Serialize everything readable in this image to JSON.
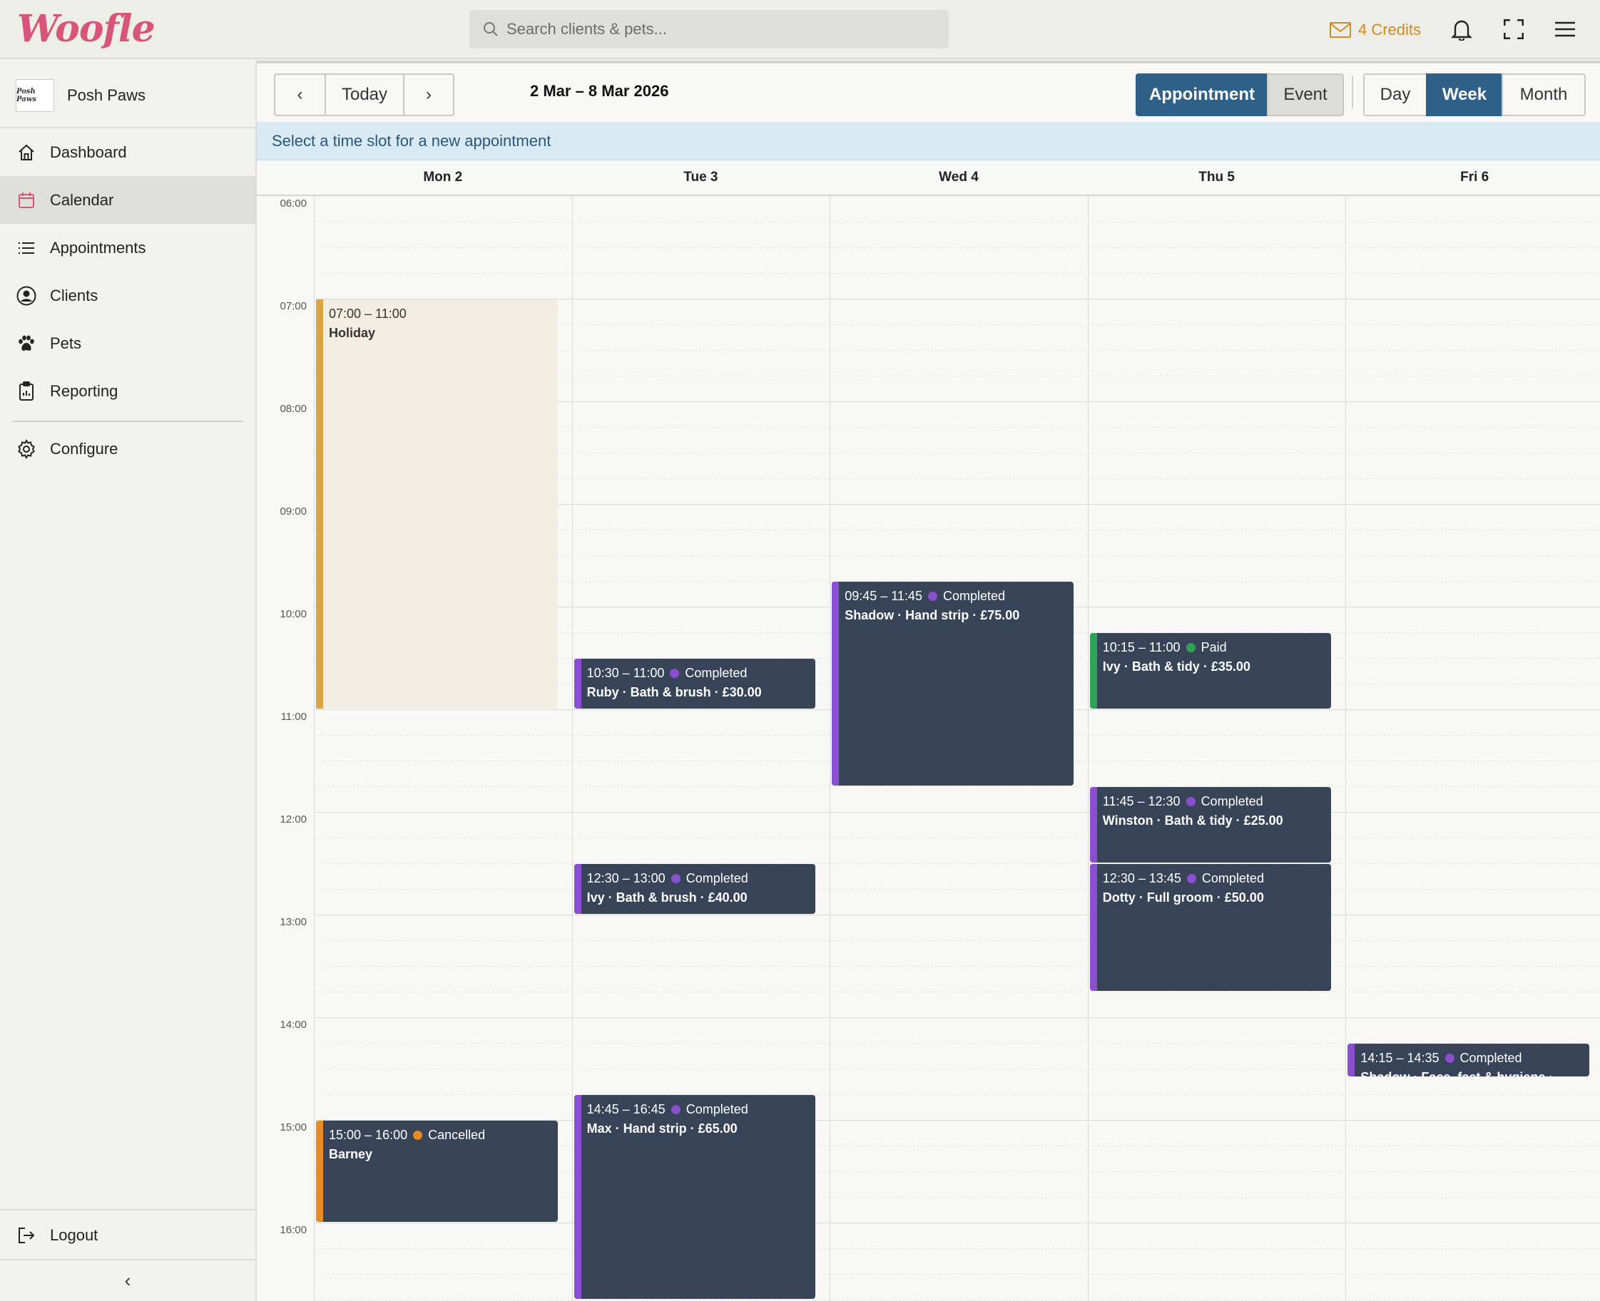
{
  "app": {
    "logo": "Woofle",
    "search_placeholder": "Search clients & pets...",
    "credits_label": "4 Credits"
  },
  "colors": {
    "accent": "#2e6088",
    "brand": "#d8557a",
    "completed": "#8a4fd0",
    "paid": "#2ea35a",
    "cancelled": "#e98a25",
    "holiday": "#d9a441"
  },
  "sidebar": {
    "org_name": "Posh Paws",
    "org_logo_text": "Posh Paws",
    "items": [
      {
        "label": "Dashboard",
        "icon": "home-icon"
      },
      {
        "label": "Calendar",
        "icon": "calendar-icon"
      },
      {
        "label": "Appointments",
        "icon": "list-icon"
      },
      {
        "label": "Clients",
        "icon": "user-circle-icon"
      },
      {
        "label": "Pets",
        "icon": "paw-icon"
      },
      {
        "label": "Reporting",
        "icon": "clipboard-icon"
      },
      {
        "label": "Configure",
        "icon": "gear-icon"
      }
    ],
    "logout_label": "Logout",
    "collapse_label": "‹"
  },
  "toolbar": {
    "prev_label": "‹",
    "today_label": "Today",
    "next_label": "›",
    "date_range": "2 Mar – 8 Mar 2026",
    "type_appointment": "Appointment",
    "type_event": "Event",
    "view_day": "Day",
    "view_week": "Week",
    "view_month": "Month",
    "active_type": "Appointment",
    "active_view": "Week"
  },
  "hint": "Select a time slot for a new appointment",
  "calendar": {
    "days": [
      "Mon 2",
      "Tue 3",
      "Wed 4",
      "Thu 5",
      "Fri 6"
    ],
    "hours": [
      "06:00",
      "07:00",
      "08:00",
      "09:00",
      "10:00",
      "11:00",
      "12:00",
      "13:00",
      "14:00",
      "15:00",
      "16:00"
    ],
    "events": [
      {
        "day": 0,
        "start": "07:00",
        "end": "11:00",
        "time": "07:00 – 11:00",
        "status": "",
        "title": "Holiday",
        "kind": "holiday"
      },
      {
        "day": 0,
        "start": "15:00",
        "end": "16:00",
        "time": "15:00 – 16:00",
        "status": "Cancelled",
        "title": "Barney",
        "kind": "cancelled"
      },
      {
        "day": 1,
        "start": "10:30",
        "end": "11:00",
        "time": "10:30 – 11:00",
        "status": "Completed",
        "title": "Ruby · Bath & brush · £30.00",
        "kind": "completed"
      },
      {
        "day": 1,
        "start": "12:30",
        "end": "13:00",
        "time": "12:30 – 13:00",
        "status": "Completed",
        "title": "Ivy · Bath & brush · £40.00",
        "kind": "completed"
      },
      {
        "day": 1,
        "start": "14:45",
        "end": "16:45",
        "time": "14:45 – 16:45",
        "status": "Completed",
        "title": "Max · Hand strip · £65.00",
        "kind": "completed"
      },
      {
        "day": 2,
        "start": "09:45",
        "end": "11:45",
        "time": "09:45 – 11:45",
        "status": "Completed",
        "title": "Shadow · Hand strip · £75.00",
        "kind": "completed"
      },
      {
        "day": 3,
        "start": "10:15",
        "end": "11:00",
        "time": "10:15 – 11:00",
        "status": "Paid",
        "title": "Ivy · Bath & tidy · £35.00",
        "kind": "paid"
      },
      {
        "day": 3,
        "start": "11:45",
        "end": "12:30",
        "time": "11:45 – 12:30",
        "status": "Completed",
        "title": "Winston · Bath & tidy · £25.00",
        "kind": "completed"
      },
      {
        "day": 3,
        "start": "12:30",
        "end": "13:45",
        "time": "12:30 – 13:45",
        "status": "Completed",
        "title": "Dotty · Full groom · £50.00",
        "kind": "completed"
      },
      {
        "day": 4,
        "start": "14:15",
        "end": "14:35",
        "time": "14:15 – 14:35",
        "status": "Completed",
        "title": "Shadow · Face, feet & hygiene ·",
        "kind": "completed"
      }
    ]
  }
}
